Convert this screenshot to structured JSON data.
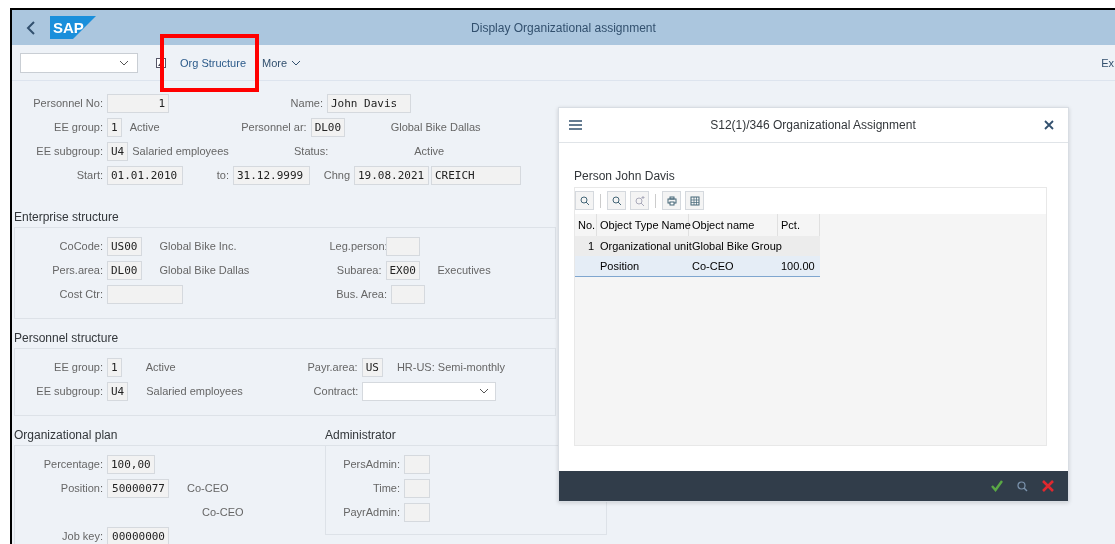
{
  "shell": {
    "title": "Display Organizational assignment",
    "logo_text": "SAP"
  },
  "toolbar": {
    "buttons": [
      {
        "label": "Org Structure",
        "has_menu": false
      },
      {
        "label": "More",
        "has_menu": true
      }
    ],
    "overflow_text": "Ex"
  },
  "header": {
    "personnel_no": {
      "label": "Personnel No:",
      "value": "1"
    },
    "name": {
      "label": "Name:",
      "value": "John Davis"
    },
    "ee_group": {
      "label": "EE group:",
      "value": "1",
      "text": "Active"
    },
    "personnel_area": {
      "label": "Personnel ar:",
      "value": "DL00",
      "text": "Global Bike Dallas"
    },
    "ee_subgroup": {
      "label": "EE subgroup:",
      "value": "U4",
      "text": "Salaried employees"
    },
    "status": {
      "label": "Status:",
      "text": "Active"
    },
    "start": {
      "label": "Start:",
      "value": "01.01.2010"
    },
    "to": {
      "label": "to:",
      "value": "31.12.9999"
    },
    "changed": {
      "label": "Chng",
      "date": "19.08.2021",
      "user": "CREICH"
    }
  },
  "enterprise_structure": {
    "title": "Enterprise structure",
    "cocode": {
      "label": "CoCode:",
      "value": "US00",
      "text": "Global Bike Inc."
    },
    "pers_area": {
      "label": "Pers.area:",
      "value": "DL00",
      "text": "Global Bike Dallas"
    },
    "cost_ctr": {
      "label": "Cost Ctr:"
    },
    "leg_person": {
      "label": "Leg.person:"
    },
    "subarea": {
      "label": "Subarea:",
      "value": "EX00",
      "text": "Executives"
    },
    "bus_area": {
      "label": "Bus. Area:"
    }
  },
  "personnel_structure": {
    "title": "Personnel structure",
    "ee_group": {
      "label": "EE group:",
      "value": "1",
      "text": "Active"
    },
    "ee_subgroup": {
      "label": "EE subgroup:",
      "value": "U4",
      "text": "Salaried employees"
    },
    "payr_area": {
      "label": "Payr.area:",
      "value": "US",
      "text": "HR-US: Semi-monthly"
    },
    "contract": {
      "label": "Contract:"
    }
  },
  "organizational_plan": {
    "title": "Organizational plan",
    "percentage": {
      "label": "Percentage:",
      "value": "100,00"
    },
    "position": {
      "label": "Position:",
      "value": "50000077",
      "text": "Co-CEO"
    },
    "second_text": "Co-CEO",
    "job_key": {
      "label": "Job key:",
      "value": "00000000"
    }
  },
  "administrator": {
    "title": "Administrator",
    "fields": [
      {
        "label": "PersAdmin:"
      },
      {
        "label": "Time:"
      },
      {
        "label": "PayrAdmin:"
      }
    ]
  },
  "dialog": {
    "title": "S12(1)/346 Organizational Assignment",
    "heading": "Person John Davis",
    "table": {
      "columns": [
        "No.",
        "Object Type Name",
        "Object name",
        "Pct."
      ],
      "rows": [
        {
          "cells": [
            "1",
            "Organizational unit",
            "Global Bike Group",
            ""
          ],
          "selected": false
        },
        {
          "cells": [
            "",
            "Position",
            "Co-CEO",
            "100.00"
          ],
          "selected": true
        }
      ]
    }
  }
}
